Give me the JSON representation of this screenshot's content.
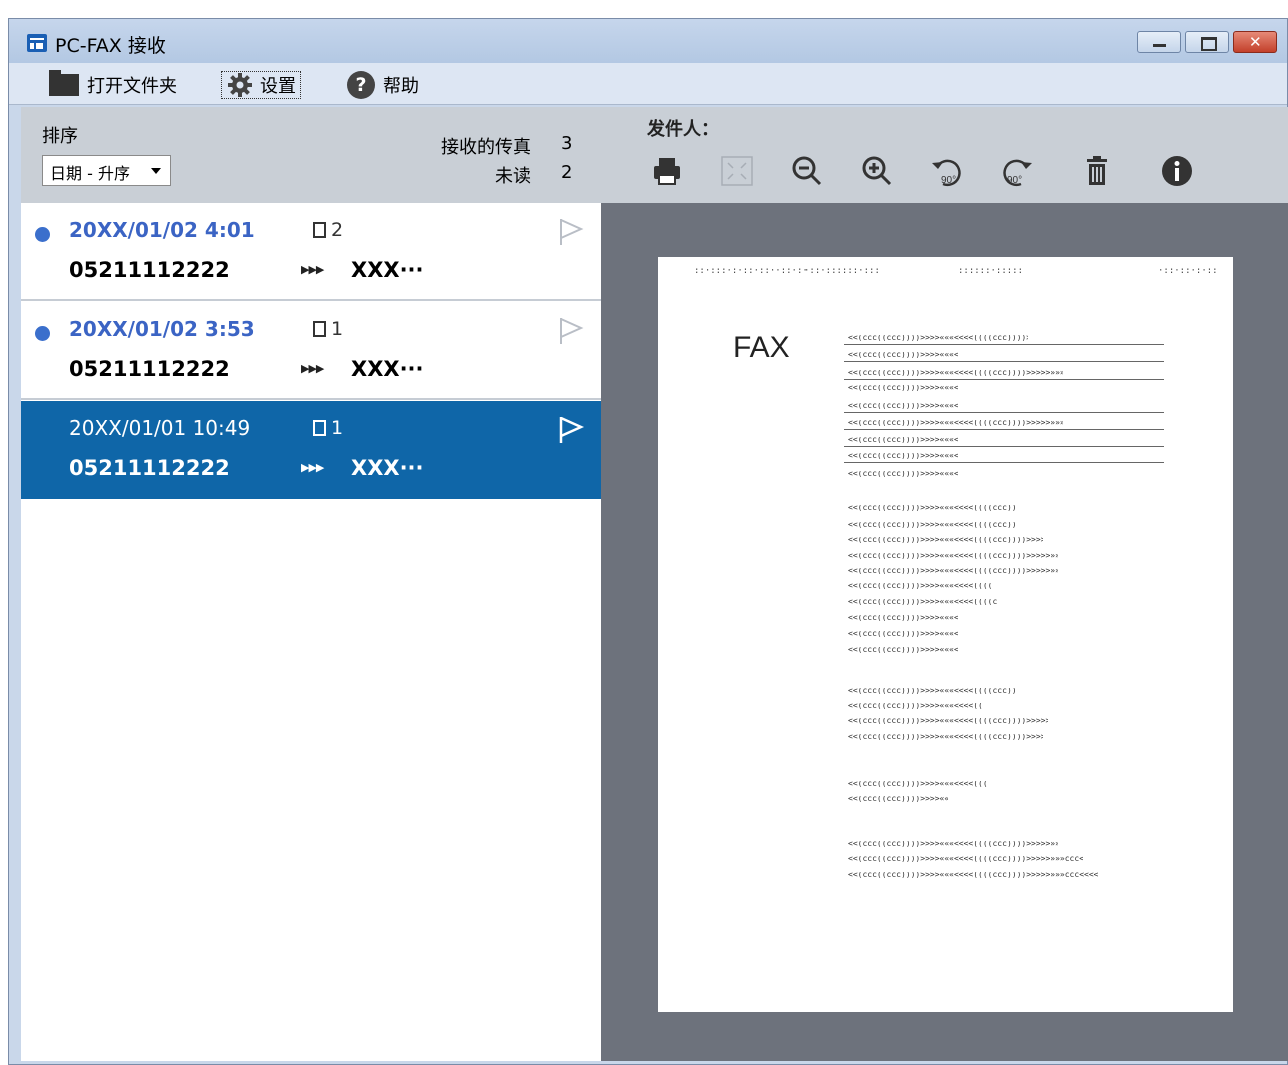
{
  "window": {
    "title": "PC-FAX 接收"
  },
  "menu": {
    "open_folder": "打开文件夹",
    "settings": "设置",
    "help": "帮助"
  },
  "list_header": {
    "sort_label": "排序",
    "sort_value": "日期 - 升序",
    "received_label": "接收的传真",
    "received_count": "3",
    "unread_label": "未读",
    "unread_count": "2"
  },
  "fax_items": [
    {
      "date": "20XX/01/02 4:01",
      "pages": "2",
      "number": "05211112222",
      "name": "XXX···",
      "unread": true,
      "selected": false
    },
    {
      "date": "20XX/01/02 3:53",
      "pages": "1",
      "number": "05211112222",
      "name": "XXX···",
      "unread": true,
      "selected": false
    },
    {
      "date": "20XX/01/01 10:49",
      "pages": "1",
      "number": "05211112222",
      "name": "XXX···",
      "unread": false,
      "selected": true
    }
  ],
  "preview": {
    "sender_label": "发件人：",
    "toolbar": [
      "print-icon",
      "fit-icon",
      "zoom-out-icon",
      "zoom-in-icon",
      "rotate-left-icon",
      "rotate-right-icon",
      "trash-icon",
      "info-icon"
    ],
    "rotate_left_label": "90°",
    "rotate_right_label": "90°",
    "fax_title": "FAX"
  },
  "colors": {
    "selected_bg": "#0f66a8",
    "unread_dot": "#3b6fcc",
    "date_text": "#3b64c4"
  }
}
